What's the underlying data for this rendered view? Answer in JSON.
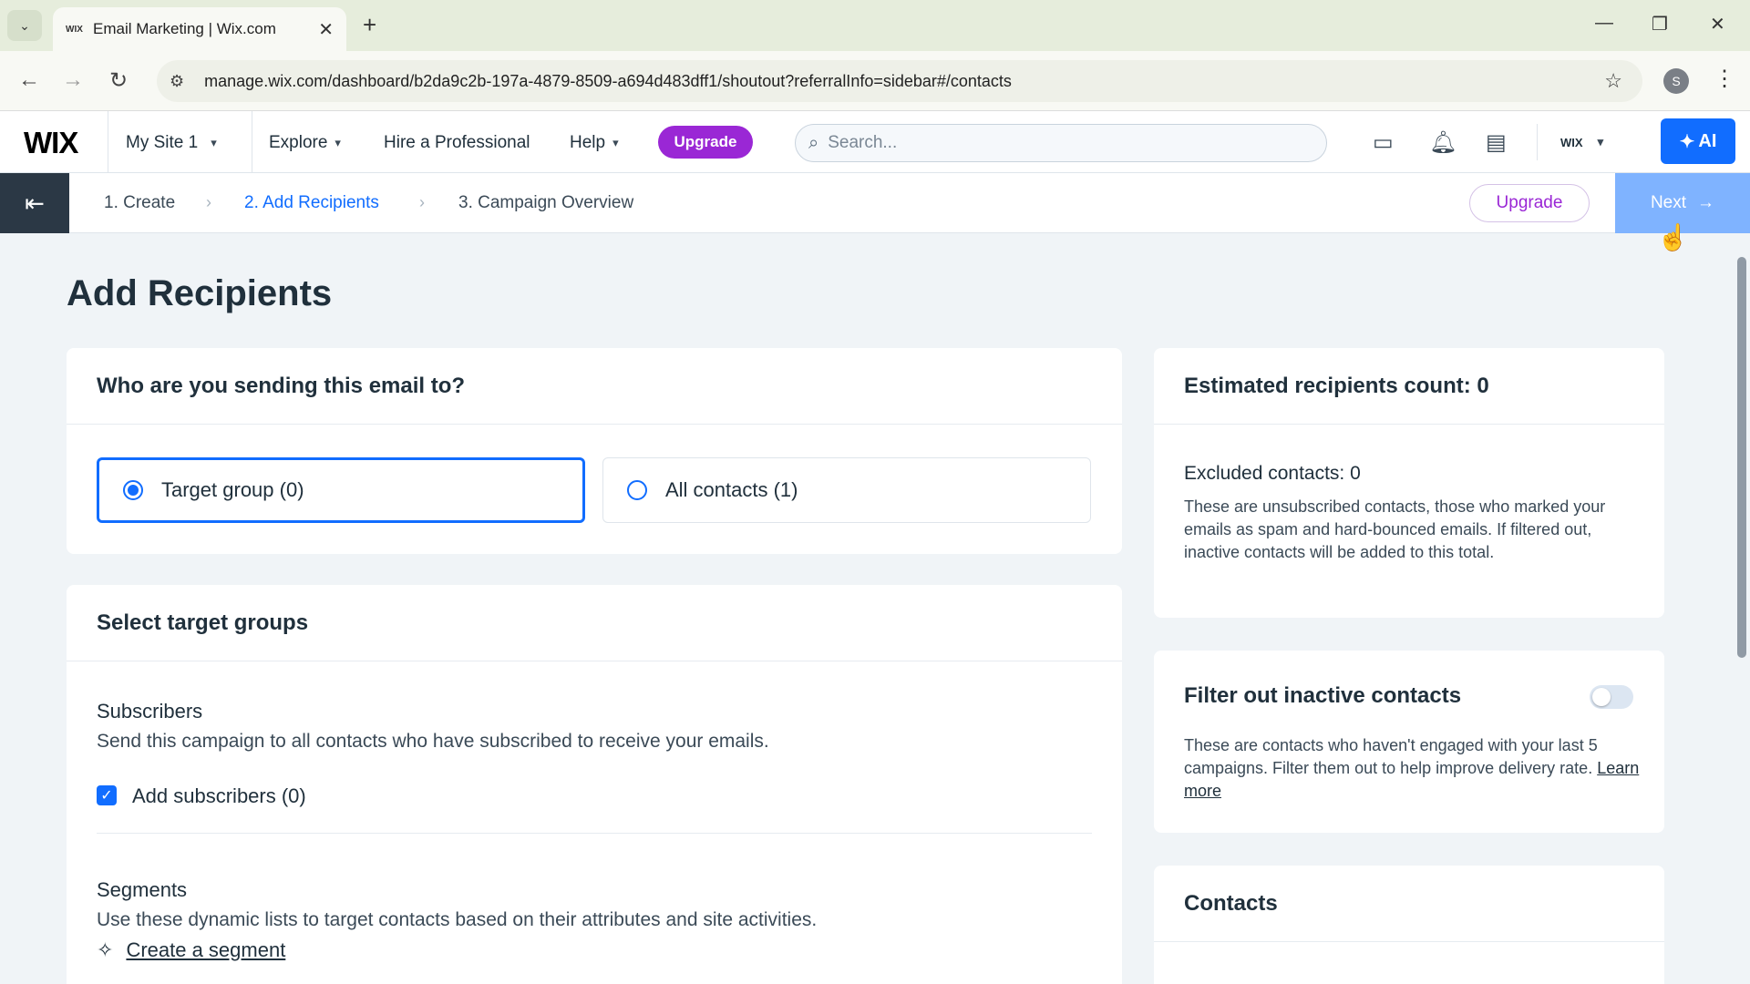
{
  "browser": {
    "tab_title": "Email Marketing | Wix.com",
    "tab_favicon": "WIX",
    "url": "manage.wix.com/dashboard/b2da9c2b-197a-4879-8509-a694d483dff1/shoutout?referralInfo=sidebar#/contacts",
    "profile_initial": "S"
  },
  "topbar": {
    "logo": "WIX",
    "site_name": "My Site 1",
    "explore": "Explore",
    "hire": "Hire a Professional",
    "help": "Help",
    "upgrade": "Upgrade",
    "search_placeholder": "Search...",
    "account_label": "WIX",
    "ai_label": "AI"
  },
  "wizard": {
    "steps": [
      "1. Create",
      "2. Add Recipients",
      "3. Campaign Overview"
    ],
    "active_step": 1,
    "upgrade": "Upgrade",
    "next": "Next"
  },
  "page": {
    "title": "Add Recipients",
    "who_card": {
      "heading": "Who are you sending this email to?",
      "options": [
        "Target group (0)",
        "All contacts (1)"
      ],
      "selected": 0
    },
    "groups_card": {
      "heading": "Select target groups",
      "subscribers_title": "Subscribers",
      "subscribers_desc": "Send this campaign to all contacts who have subscribed to receive your emails.",
      "add_subscribers": "Add subscribers (0)",
      "add_subscribers_checked": true,
      "segments_title": "Segments",
      "segments_desc": "Use these dynamic lists to target contacts based on their attributes and site activities.",
      "create_segment": "Create a segment"
    },
    "estimate_card": {
      "heading": "Estimated recipients count: 0",
      "excluded": "Excluded contacts: 0",
      "excluded_desc": "These are unsubscribed contacts, those who marked your emails as spam and hard-bounced emails. If filtered out, inactive contacts will be added to this total."
    },
    "filter_card": {
      "heading": "Filter out inactive contacts",
      "toggle_on": false,
      "desc": "These are contacts who haven't engaged with your last 5 campaigns. Filter them out to help improve delivery rate.",
      "learn_more": "Learn more"
    },
    "contacts_card": {
      "heading": "Contacts"
    }
  },
  "colors": {
    "accent": "#116dff",
    "upgrade": "#9a27d5",
    "next_disabled": "#7fb3ff",
    "exit": "#2b3845"
  }
}
